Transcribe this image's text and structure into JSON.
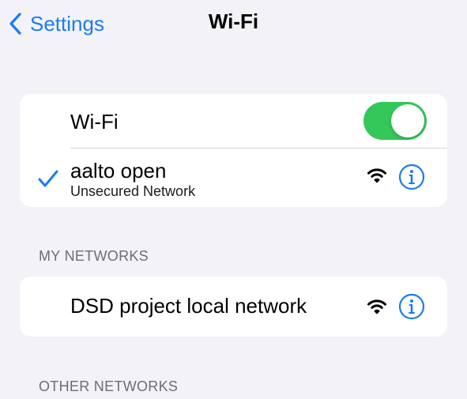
{
  "nav": {
    "back_label": "Settings",
    "title": "Wi-Fi",
    "back_icon": "chevron-left-icon"
  },
  "wifi_toggle": {
    "label": "Wi-Fi",
    "state": "on",
    "on_color": "#34c759"
  },
  "current_network": {
    "name": "aalto open",
    "subtitle": "Unsecured Network",
    "selected": true,
    "check_icon": "checkmark-icon",
    "signal_icon": "wifi-signal-icon",
    "info_icon": "info-icon"
  },
  "my_networks": {
    "header": "MY NETWORKS",
    "items": [
      {
        "name": "DSD project local network",
        "signal_icon": "wifi-signal-icon",
        "info_icon": "info-icon"
      }
    ]
  },
  "other_networks": {
    "header": "OTHER NETWORKS"
  },
  "colors": {
    "accent": "#1a7cf0",
    "background": "#f2f2f7",
    "card": "#ffffff",
    "section_header": "#6d6d72"
  }
}
